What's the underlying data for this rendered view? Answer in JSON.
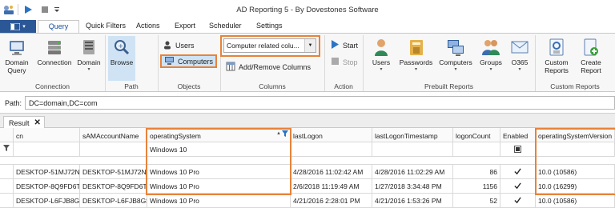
{
  "window": {
    "title": "AD Reporting 5 - By Dovestones Software"
  },
  "ribbon_tabs": [
    "Query",
    "Quick Filters",
    "Actions",
    "Export",
    "Scheduler",
    "Settings"
  ],
  "groups": {
    "connection": {
      "label": "Connection",
      "domain_query": "Domain\nQuery",
      "connection": "Connection",
      "domain": "Domain"
    },
    "path": {
      "label": "Path",
      "browse": "Browse"
    },
    "objects": {
      "label": "Objects",
      "users": "Users",
      "computers": "Computers"
    },
    "columns": {
      "label": "Columns",
      "preset": "Computer related colu...",
      "add_remove": "Add/Remove Columns"
    },
    "action": {
      "label": "Action",
      "start": "Start",
      "stop": "Stop"
    },
    "prebuilt": {
      "label": "Prebuilt Reports",
      "users": "Users",
      "passwords": "Passwords",
      "computers": "Computers",
      "groups": "Groups",
      "o365": "O365"
    },
    "custom": {
      "label": "Custom Reports",
      "custom_reports": "Custom\nReports",
      "create_report": "Create\nReport"
    }
  },
  "path": {
    "label": "Path:",
    "value": "DC=domain,DC=com"
  },
  "result_tab": {
    "label": "Result"
  },
  "grid": {
    "columns": [
      "cn",
      "sAMAccountName",
      "operatingSystem",
      "lastLogon",
      "lastLogonTimestamp",
      "logonCount",
      "Enabled",
      "operatingSystemVersion"
    ],
    "filter_value": "Windows 10",
    "rows": [
      {
        "cn": "DESKTOP-51MJ72N",
        "sam": "DESKTOP-51MJ72N$",
        "os": "Windows 10 Pro",
        "lastLogon": "4/28/2016 11:02:42 AM",
        "lastLogonTimestamp": "4/28/2016 11:02:29 AM",
        "logonCount": "86",
        "enabled": true,
        "osv": "10.0 (10586)"
      },
      {
        "cn": "DESKTOP-8Q9FD6T",
        "sam": "DESKTOP-8Q9FD6T$",
        "os": "Windows 10 Pro",
        "lastLogon": "2/6/2018 11:19:49 AM",
        "lastLogonTimestamp": "1/27/2018 3:34:48 PM",
        "logonCount": "1156",
        "enabled": true,
        "osv": "10.0 (16299)"
      },
      {
        "cn": "DESKTOP-L6FJB8G",
        "sam": "DESKTOP-L6FJB8G$",
        "os": "Windows 10 Pro",
        "lastLogon": "4/21/2016 2:28:01 PM",
        "lastLogonTimestamp": "4/21/2016 1:53:26 PM",
        "logonCount": "52",
        "enabled": true,
        "osv": "10.0 (10586)"
      }
    ]
  },
  "colors": {
    "highlight": "#e8823a",
    "accent": "#2b5797",
    "selected": "#cfe3f5"
  }
}
